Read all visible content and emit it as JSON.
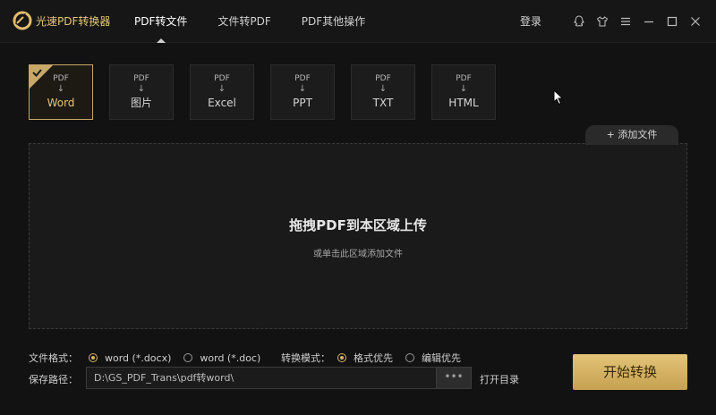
{
  "app": {
    "name": "光速PDF转换器"
  },
  "nav": {
    "items": [
      {
        "label": "PDF转文件",
        "active": true
      },
      {
        "label": "文件转PDF",
        "active": false
      },
      {
        "label": "PDF其他操作",
        "active": false
      }
    ],
    "login": "登录"
  },
  "window_icons": [
    "qq-icon",
    "skin-icon",
    "menu-icon",
    "minimize-icon",
    "maximize-icon",
    "close-icon"
  ],
  "formats": [
    {
      "source": "PDF",
      "arrow": "↓",
      "target": "Word",
      "active": true
    },
    {
      "source": "PDF",
      "arrow": "↓",
      "target": "图片",
      "active": false
    },
    {
      "source": "PDF",
      "arrow": "↓",
      "target": "Excel",
      "active": false
    },
    {
      "source": "PDF",
      "arrow": "↓",
      "target": "PPT",
      "active": false
    },
    {
      "source": "PDF",
      "arrow": "↓",
      "target": "TXT",
      "active": false
    },
    {
      "source": "PDF",
      "arrow": "↓",
      "target": "HTML",
      "active": false
    }
  ],
  "dropzone": {
    "add_file_label": "+ 添加文件",
    "title": "拖拽PDF到本区域上传",
    "subtitle": "或单击此区域添加文件"
  },
  "options": {
    "format_label": "文件格式：",
    "format_choices": [
      "word (*.docx)",
      "word (*.doc)"
    ],
    "format_selected": 0,
    "mode_label": "转换模式：",
    "mode_choices": [
      "格式优先",
      "编辑优先"
    ],
    "mode_selected": 0,
    "save_label": "保存路径：",
    "save_path": "D:\\GS_PDF_Trans\\pdf转word\\",
    "browse_label": "•••",
    "open_dir_label": "打开目录"
  },
  "start_button": "开始转换",
  "colors": {
    "accent": "#d6b46a",
    "background": "#121212",
    "panel": "#1a1a1a"
  }
}
